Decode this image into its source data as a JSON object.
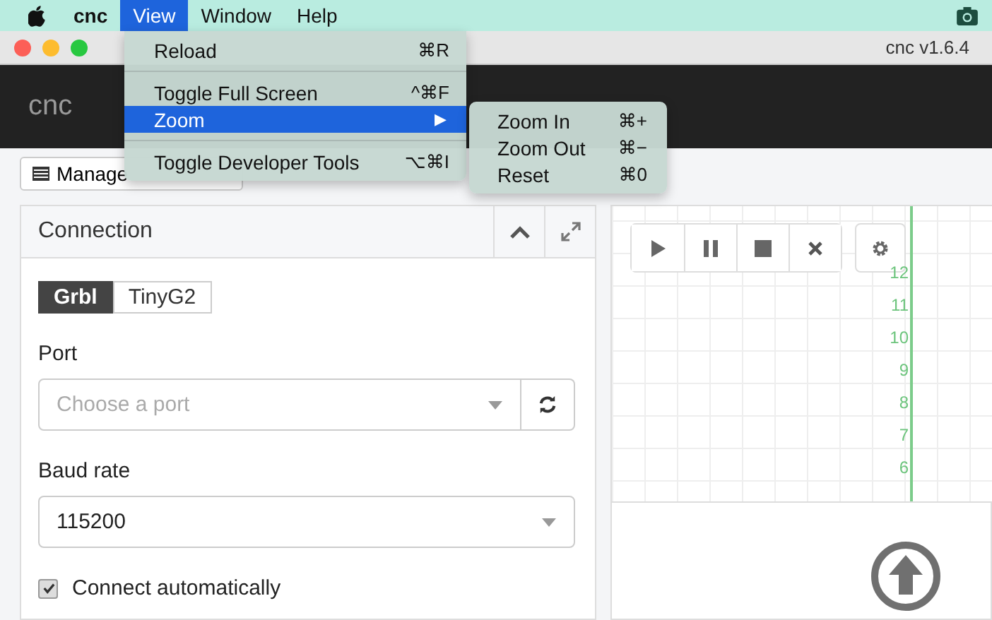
{
  "menubar": {
    "items": [
      {
        "label": "cnc",
        "kind": "app",
        "selected": false
      },
      {
        "label": "View",
        "kind": "menu",
        "selected": true
      },
      {
        "label": "Window",
        "kind": "menu",
        "selected": false
      },
      {
        "label": "Help",
        "kind": "menu",
        "selected": false
      }
    ]
  },
  "view_menu": {
    "items": [
      {
        "kind": "item",
        "label": "Reload",
        "shortcut": "⌘R",
        "selected": false
      },
      {
        "kind": "separator"
      },
      {
        "kind": "item",
        "label": "Toggle Full Screen",
        "shortcut": "^⌘F",
        "selected": false
      },
      {
        "kind": "submenu",
        "label": "Zoom",
        "shortcut": "▶",
        "selected": true
      },
      {
        "kind": "separator"
      },
      {
        "kind": "item",
        "label": "Toggle Developer Tools",
        "shortcut": "⌥⌘I",
        "selected": false
      }
    ]
  },
  "zoom_submenu": {
    "items": [
      {
        "label": "Zoom In",
        "shortcut": "⌘+"
      },
      {
        "label": "Zoom Out",
        "shortcut": "⌘−"
      },
      {
        "label": "Reset",
        "shortcut": "⌘0"
      }
    ]
  },
  "window": {
    "title": "cnc v1.6.4"
  },
  "header": {
    "brand": "cnc"
  },
  "manage_button": {
    "label": "Manage"
  },
  "connection_panel": {
    "title": "Connection",
    "tabs": [
      {
        "label": "Grbl",
        "selected": true
      },
      {
        "label": "TinyG2",
        "selected": false
      }
    ],
    "port": {
      "label": "Port",
      "placeholder": "Choose a port"
    },
    "baud_rate": {
      "label": "Baud rate",
      "value": "115200"
    },
    "auto_connect": {
      "label": "Connect automatically",
      "checked": true
    }
  },
  "axis": {
    "labels": [
      "12",
      "11",
      "10",
      "9",
      "8",
      "7",
      "6"
    ]
  }
}
